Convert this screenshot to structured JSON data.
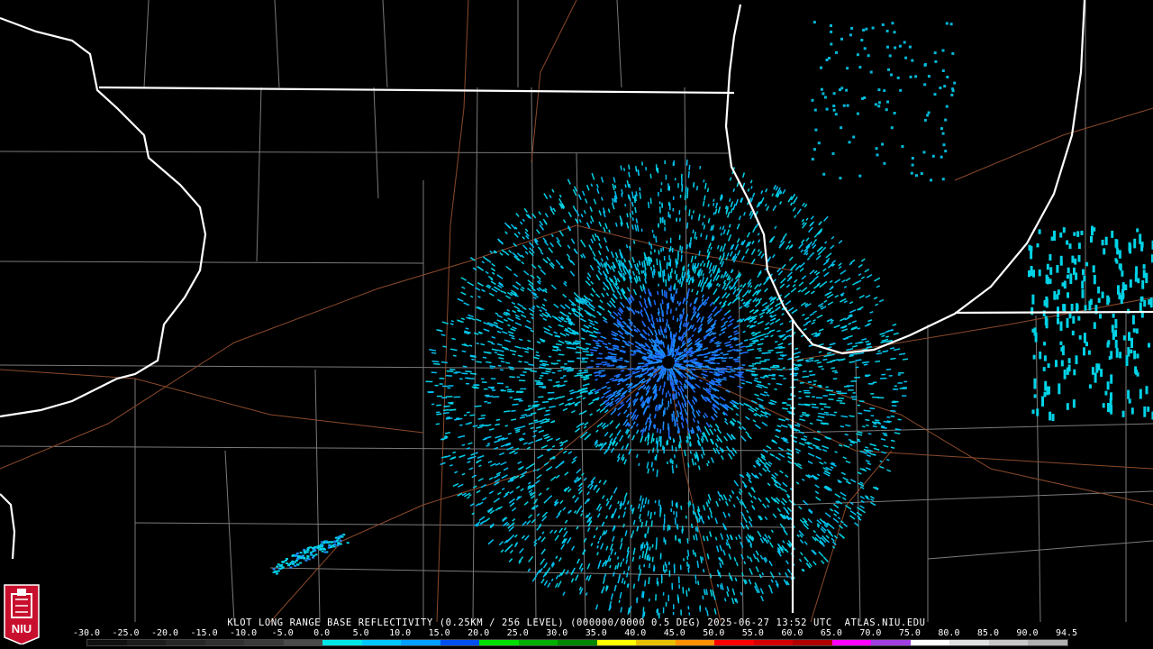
{
  "caption": "KLOT LONG RANGE BASE REFLECTIVITY (0.25KM / 256 LEVEL) (000000/0000 0.5 DEG) 2025-06-27 13:52 UTC  ATLAS.NIU.EDU",
  "scale": {
    "labels": [
      "-30.0",
      "-25.0",
      "-20.0",
      "-15.0",
      "-10.0",
      "-5.0",
      "0.0",
      "5.0",
      "10.0",
      "15.0",
      "20.0",
      "25.0",
      "30.0",
      "35.0",
      "40.0",
      "45.0",
      "50.0",
      "55.0",
      "60.0",
      "65.0",
      "70.0",
      "75.0",
      "80.0",
      "85.0",
      "90.0",
      "94.5"
    ],
    "colors": [
      "#101010",
      "#1c1c1c",
      "#262626",
      "#303030",
      "#3a3a3a",
      "#4a4a4a",
      "#00e6e6",
      "#00c8ff",
      "#00a0ff",
      "#0050f0",
      "#00e000",
      "#00b000",
      "#008800",
      "#ffff00",
      "#e6c000",
      "#ff9000",
      "#ff0000",
      "#d40000",
      "#b00000",
      "#ff00ff",
      "#a040e0",
      "#ffffff",
      "#e0e0e0",
      "#c8c8c8",
      "#b0b0b0"
    ]
  },
  "logo": {
    "text": "NIU",
    "colors": {
      "red": "#c8102e",
      "white": "#ffffff"
    }
  },
  "map": {
    "radar_site": "KLOT",
    "colors": {
      "background": "#000000",
      "state_lines": "#ffffff",
      "county_lines": "#7a7a7a",
      "roads": "#8b4a2b",
      "light_echo": "#00d2e6",
      "medium_echo": "#1e8cff",
      "strong_echo": "#1a3cff"
    }
  }
}
